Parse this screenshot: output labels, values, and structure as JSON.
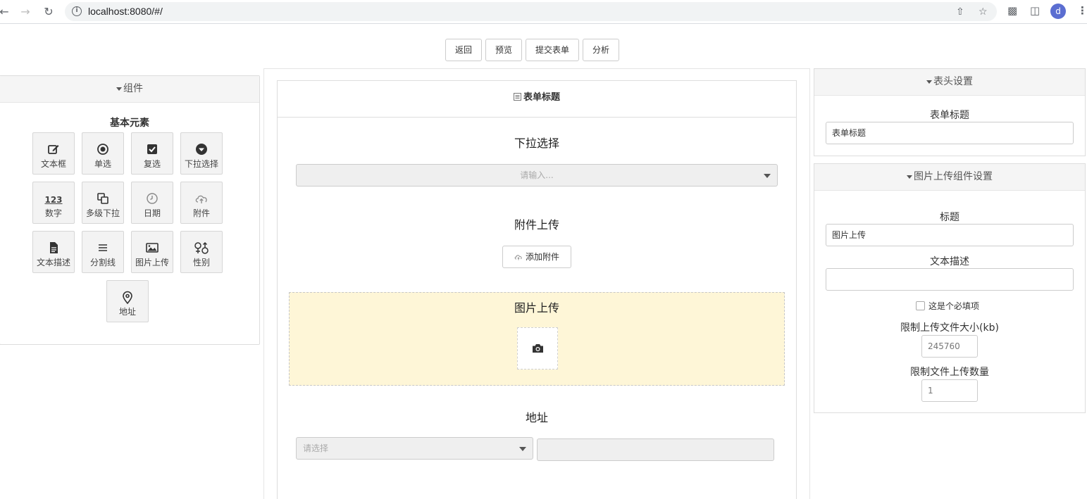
{
  "browser": {
    "url": "localhost:8080/#/",
    "profile_initial": "d"
  },
  "actions": {
    "back": "返回",
    "preview": "预览",
    "submit": "提交表单",
    "analyze": "分析"
  },
  "components_panel": {
    "title": "组件",
    "section": "基本元素",
    "items": [
      {
        "label": "文本框",
        "icon": "edit-icon"
      },
      {
        "label": "单选",
        "icon": "radio-icon"
      },
      {
        "label": "复选",
        "icon": "checkbox-icon"
      },
      {
        "label": "下拉选择",
        "icon": "dropdown-icon"
      },
      {
        "label": "数字",
        "icon": "number-icon",
        "icon_text": "123"
      },
      {
        "label": "多级下拉",
        "icon": "cascade-icon"
      },
      {
        "label": "日期",
        "icon": "clock-icon"
      },
      {
        "label": "附件",
        "icon": "cloud-upload-icon"
      },
      {
        "label": "文本描述",
        "icon": "document-icon"
      },
      {
        "label": "分割线",
        "icon": "divider-icon"
      },
      {
        "label": "图片上传",
        "icon": "image-icon"
      },
      {
        "label": "性别",
        "icon": "gender-icon"
      },
      {
        "label": "地址",
        "icon": "location-pin-icon"
      }
    ]
  },
  "form": {
    "title": "表单标题",
    "dropdown": {
      "title": "下拉选择",
      "placeholder": "请输入..."
    },
    "attachment": {
      "title": "附件上传",
      "button": "添加附件"
    },
    "image_upload": {
      "title": "图片上传"
    },
    "address": {
      "title": "地址",
      "placeholder": "请选择"
    }
  },
  "header_settings": {
    "title": "表头设置",
    "form_title_label": "表单标题",
    "form_title_value": "表单标题"
  },
  "image_settings": {
    "title": "图片上传组件设置",
    "title_label": "标题",
    "title_value": "图片上传",
    "desc_label": "文本描述",
    "desc_value": "",
    "required_label": "这是个必填项",
    "size_label": "限制上传文件大小(kb)",
    "size_value": "245760",
    "count_label": "限制文件上传数量",
    "count_value": "1"
  },
  "colors": {
    "upload_highlight": "#fef6d7",
    "avatar": "#5b6ed1"
  }
}
